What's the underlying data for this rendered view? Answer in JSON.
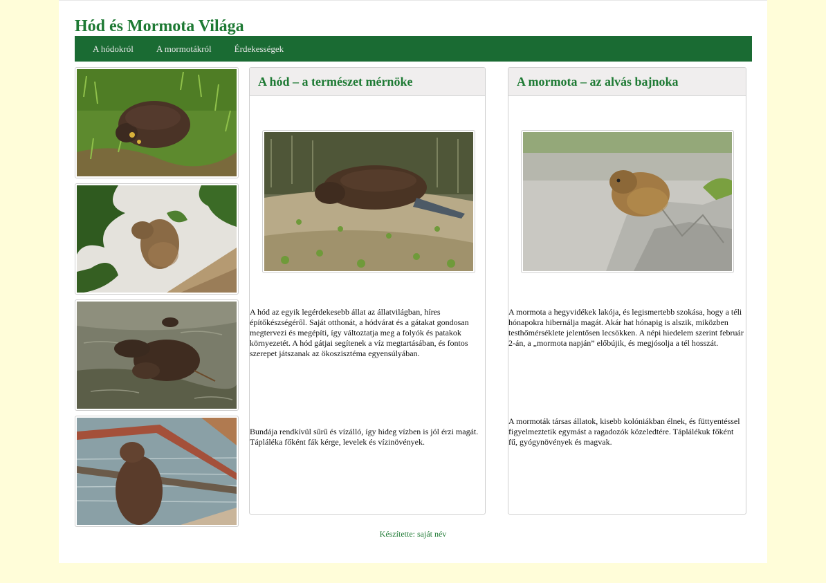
{
  "site": {
    "title": "Hód és Mormota Világa"
  },
  "nav": {
    "items": [
      {
        "label": "A hódokról"
      },
      {
        "label": "A mormotákról"
      },
      {
        "label": "Érdekességek"
      }
    ]
  },
  "cards": {
    "beaver": {
      "title": "A hód – a természet mérnöke",
      "paragraphs": [
        "A hód az egyik legérdekesebb állat az állatvilágban, híres építőkészségéről. Saját otthonát, a hódvárat és a gátakat gondosan megtervezi és megépíti, így változtatja meg a folyók és patakok környezetét. A hód gátjai segítenek a víz megtartásában, és fontos szerepet játszanak az ökoszisztéma egyensúlyában.",
        "Bundája rendkívül sűrű és vízálló, így hideg vízben is jól érzi magát. Tápláléka főként fák kérge, levelek és vízinövények."
      ]
    },
    "marmot": {
      "title": "A mormota – az alvás bajnoka",
      "paragraphs": [
        "A mormota a hegyvidékek lakója, és legismertebb szokása, hogy a téli hónapokra hibernálja magát. Akár hat hónapig is alszik, miközben testhőmérséklete jelentősen lecsökken. A népi hiedelem szerint február 2-án, a „mormota napján” előbújik, és megjósolja a tél hosszát.",
        "A mormoták társas állatok, kisebb kolóniákban élnek, és füttyentéssel figyelmeztetik egymást a ragadozók közeledtére. Táplálékuk főként fű, gyógynövények és magvak."
      ]
    }
  },
  "footer": {
    "text": "Készítette: saját név"
  }
}
